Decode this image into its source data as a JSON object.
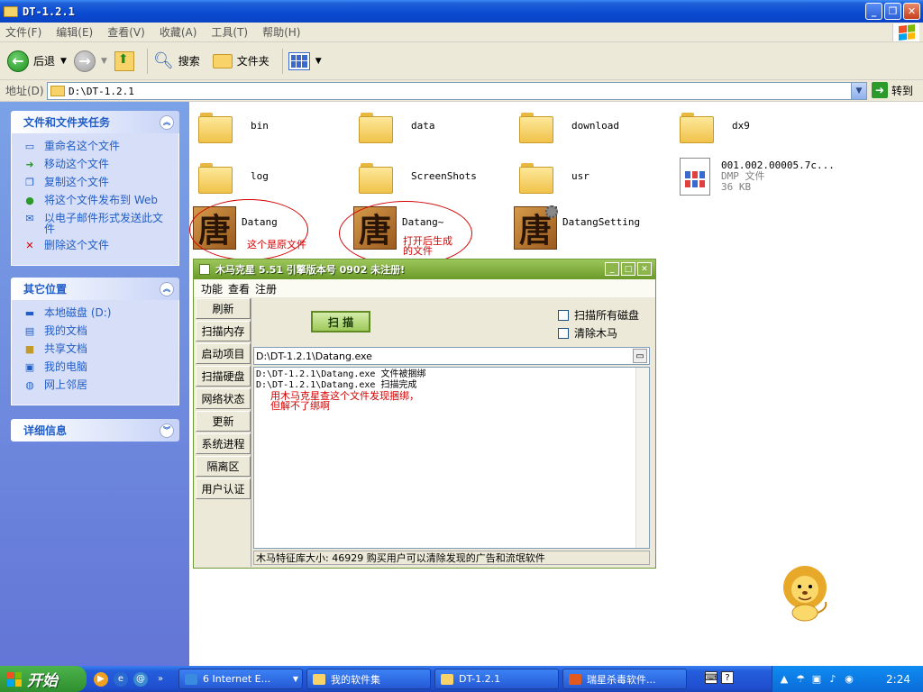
{
  "window": {
    "title": "DT-1.2.1"
  },
  "menu": [
    "文件(F)",
    "编辑(E)",
    "查看(V)",
    "收藏(A)",
    "工具(T)",
    "帮助(H)"
  ],
  "toolbar": {
    "back": "后退",
    "search": "搜索",
    "folders": "文件夹"
  },
  "address": {
    "label": "地址(D)",
    "value": "D:\\DT-1.2.1",
    "go": "转到"
  },
  "tasks_panel": {
    "title": "文件和文件夹任务",
    "items": [
      "重命名这个文件",
      "移动这个文件",
      "复制这个文件",
      "将这个文件发布到 Web",
      "以电子邮件形式发送此文件",
      "删除这个文件"
    ]
  },
  "places_panel": {
    "title": "其它位置",
    "items": [
      "本地磁盘 (D:)",
      "我的文档",
      "共享文档",
      "我的电脑",
      "网上邻居"
    ]
  },
  "details_panel": {
    "title": "详细信息"
  },
  "files": {
    "folders": [
      "bin",
      "data",
      "download",
      "dx9",
      "log",
      "ScreenShots",
      "usr"
    ],
    "dmp": {
      "name": "001.002.00005.7c...",
      "type": "DMP 文件",
      "size": "36 KB"
    },
    "programs": [
      "Datang",
      "Datang~",
      "DatangSetting"
    ]
  },
  "annotations": {
    "original": "这个是原文件",
    "generated": "打开后生成的文件"
  },
  "trojan_killer": {
    "title": "木马克星 5.51 引擎版本号 0902 未注册!",
    "menu": [
      "功能",
      "查看",
      "注册"
    ],
    "side_buttons": [
      "刷新",
      "扫描内存",
      "启动项目",
      "扫描硬盘",
      "网络状态",
      "更新",
      "系统进程",
      "隔离区",
      "用户认证"
    ],
    "scan_button": "扫 描",
    "check_all_disks": "扫描所有磁盘",
    "check_remove": "清除木马",
    "path": "D:\\DT-1.2.1\\Datang.exe",
    "log": [
      "D:\\DT-1.2.1\\Datang.exe 文件被捆绑",
      "D:\\DT-1.2.1\\Datang.exe 扫描完成"
    ],
    "annotation": "用木马克星查这个文件发现捆绑，但解不了绑啊",
    "status": "木马特征库大小: 46929 购买用户可以清除发现的广告和流氓软件"
  },
  "taskbar": {
    "start": "开始",
    "tasks": [
      "6 Internet E...",
      "我的软件集",
      "DT-1.2.1",
      "瑞星杀毒软件..."
    ],
    "clock": "2:24"
  },
  "colors": {
    "title_blue": "#0a4ad1",
    "task_pane_blue": "#6375d6",
    "annotation_red": "#d40000",
    "tk_green": "#6a9a2a"
  }
}
